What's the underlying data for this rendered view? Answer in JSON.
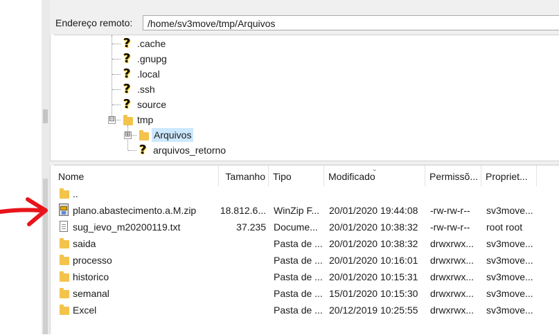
{
  "address": {
    "label": "Endereço remoto:",
    "path": "/home/sv3move/tmp/Arquivos"
  },
  "tree": {
    "items": [
      {
        "label": ".cache",
        "icon": "question-icon"
      },
      {
        "label": ".gnupg",
        "icon": "question-icon"
      },
      {
        "label": ".local",
        "icon": "question-icon"
      },
      {
        "label": ".ssh",
        "icon": "question-icon"
      },
      {
        "label": "source",
        "icon": "question-icon"
      },
      {
        "label": "tmp",
        "icon": "folder-icon",
        "expander": "⊟"
      },
      {
        "label": "Arquivos",
        "icon": "folder-icon",
        "expander": "⊞",
        "selected": true
      },
      {
        "label": "arquivos_retorno",
        "icon": "question-icon"
      }
    ]
  },
  "file_list": {
    "columns": [
      "Nome",
      "Tamanho",
      "Tipo",
      "Modificado",
      "Permissõ...",
      "Propriet..."
    ],
    "rows": [
      {
        "name": "..",
        "size": "",
        "type": "",
        "modified": "",
        "perms": "",
        "owner": "",
        "icon": "folder-icon"
      },
      {
        "name": "plano.abastecimento.a.M.zip",
        "size": "18.812.6...",
        "type": "WinZip F...",
        "modified": "20/01/2020 19:44:08",
        "perms": "-rw-rw-r--",
        "owner": "sv3move...",
        "icon": "zip-icon"
      },
      {
        "name": "sug_ievo_m20200119.txt",
        "size": "37.235",
        "type": "Docume...",
        "modified": "20/01/2020 10:38:32",
        "perms": "-rw-rw-r--",
        "owner": "root root",
        "icon": "text-file-icon"
      },
      {
        "name": "saida",
        "size": "",
        "type": "Pasta de ...",
        "modified": "20/01/2020 10:38:32",
        "perms": "drwxrwx...",
        "owner": "sv3move...",
        "icon": "folder-icon"
      },
      {
        "name": "processo",
        "size": "",
        "type": "Pasta de ...",
        "modified": "20/01/2020 10:16:01",
        "perms": "drwxrwx...",
        "owner": "sv3move...",
        "icon": "folder-icon"
      },
      {
        "name": "historico",
        "size": "",
        "type": "Pasta de ...",
        "modified": "20/01/2020 10:15:31",
        "perms": "drwxrwx...",
        "owner": "sv3move...",
        "icon": "folder-icon"
      },
      {
        "name": "semanal",
        "size": "",
        "type": "Pasta de ...",
        "modified": "15/01/2020 10:15:30",
        "perms": "drwxrwx...",
        "owner": "sv3move...",
        "icon": "folder-icon"
      },
      {
        "name": "Excel",
        "size": "",
        "type": "Pasta de ...",
        "modified": "20/12/2019 10:25:55",
        "perms": "drwxrwx...",
        "owner": "sv3move...",
        "icon": "folder-icon"
      }
    ]
  },
  "colors": {
    "annotation_arrow": "#e8141b",
    "folder": "#f3c34b",
    "selection": "#cce8ff"
  }
}
